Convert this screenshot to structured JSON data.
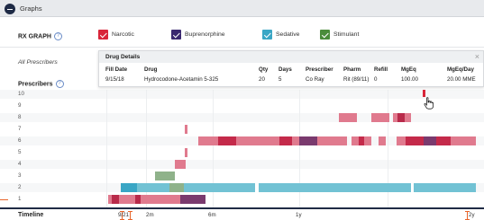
{
  "header": {
    "title": "Graphs"
  },
  "rx_graph": {
    "label": "RX GRAPH",
    "help": "?",
    "legend": [
      {
        "label": "Narcotic",
        "color": "#d9263a"
      },
      {
        "label": "Buprenorphine",
        "color": "#3a2870"
      },
      {
        "label": "Sedative",
        "color": "#3aa6c5"
      },
      {
        "label": "Stimulant",
        "color": "#4a8c3a"
      }
    ]
  },
  "filter": {
    "prescriber_value": "All Prescribers"
  },
  "prescribers": {
    "label": "Prescribers",
    "help": "?",
    "rows": [
      "10",
      "9",
      "8",
      "7",
      "6",
      "5",
      "4",
      "3",
      "2",
      "1"
    ]
  },
  "drug_details": {
    "title": "Drug Details",
    "close": "×",
    "columns": [
      "Fill Date",
      "Drug",
      "Qty",
      "Days",
      "Prescriber",
      "Pharm",
      "Refill",
      "MgEq",
      "MgEq/Day"
    ],
    "row": [
      "9/15/18",
      "Hydrocodone-Acetamin 5-325",
      "20",
      "5",
      "Co Ray",
      "Rit (89/11)",
      "0",
      "100.00",
      "20.00 MME"
    ]
  },
  "timeline": {
    "label": "Timeline",
    "ticks": [
      "9/21",
      "2m",
      "6m",
      "1y",
      "2y"
    ]
  },
  "colors": {
    "narcotic_light": "#e07a8e",
    "narcotic_dark": "#c42a4a",
    "sedative": "#72c2d4",
    "stimulant": "#8fb28a",
    "buprenorphine": "#7a3a6e"
  }
}
